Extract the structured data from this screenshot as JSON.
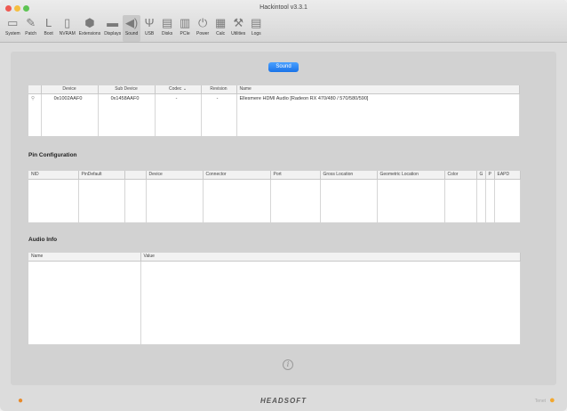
{
  "window": {
    "title": "Hackintool v3.3.1"
  },
  "toolbar": {
    "items": [
      {
        "label": "System",
        "icon": "monitor-icon",
        "glyph": "▭"
      },
      {
        "label": "Patch",
        "icon": "pencil-icon",
        "glyph": "✎"
      },
      {
        "label": "Boot",
        "icon": "boot-icon",
        "glyph": "L"
      },
      {
        "label": "NVRAM",
        "icon": "chip-icon",
        "glyph": "▯"
      },
      {
        "label": "Extensions",
        "icon": "extension-icon",
        "glyph": "⬢"
      },
      {
        "label": "Displays",
        "icon": "display-icon",
        "glyph": "▬"
      },
      {
        "label": "Sound",
        "icon": "speaker-icon",
        "glyph": "◀)"
      },
      {
        "label": "USB",
        "icon": "usb-icon",
        "glyph": "Ψ"
      },
      {
        "label": "Disks",
        "icon": "disk-icon",
        "glyph": "▤"
      },
      {
        "label": "PCIe",
        "icon": "pcie-icon",
        "glyph": "▥"
      },
      {
        "label": "Power",
        "icon": "power-icon",
        "glyph": "⏻"
      },
      {
        "label": "Calc",
        "icon": "calculator-icon",
        "glyph": "▦"
      },
      {
        "label": "Utilities",
        "icon": "wrench-icon",
        "glyph": "⚒"
      },
      {
        "label": "Logs",
        "icon": "logs-icon",
        "glyph": "▤"
      }
    ],
    "active": "Sound"
  },
  "section_button": "Sound",
  "device_table": {
    "headers": [
      "",
      "Device",
      "Sub Device",
      "Codec",
      "Revision",
      "Name"
    ],
    "rows": [
      {
        "device": "0x1002AAF0",
        "sub_device": "0x1458AAF0",
        "codec": "-",
        "revision": "-",
        "name": "Ellesmere HDMI Audio [Radeon RX 470/480 / 570/580/590]"
      }
    ]
  },
  "pin_configuration": {
    "heading": "Pin Configuration",
    "headers": [
      "NID",
      "PinDefault",
      "",
      "Device",
      "Connector",
      "Port",
      "Gross Location",
      "Geometric Location",
      "Color",
      "G",
      "P",
      "EAPD"
    ]
  },
  "audio_info": {
    "heading": "Audio Info",
    "headers": [
      "Name",
      "Value"
    ]
  },
  "footer": {
    "brand": "HEADSOFT",
    "tip_label": "Tenet"
  }
}
